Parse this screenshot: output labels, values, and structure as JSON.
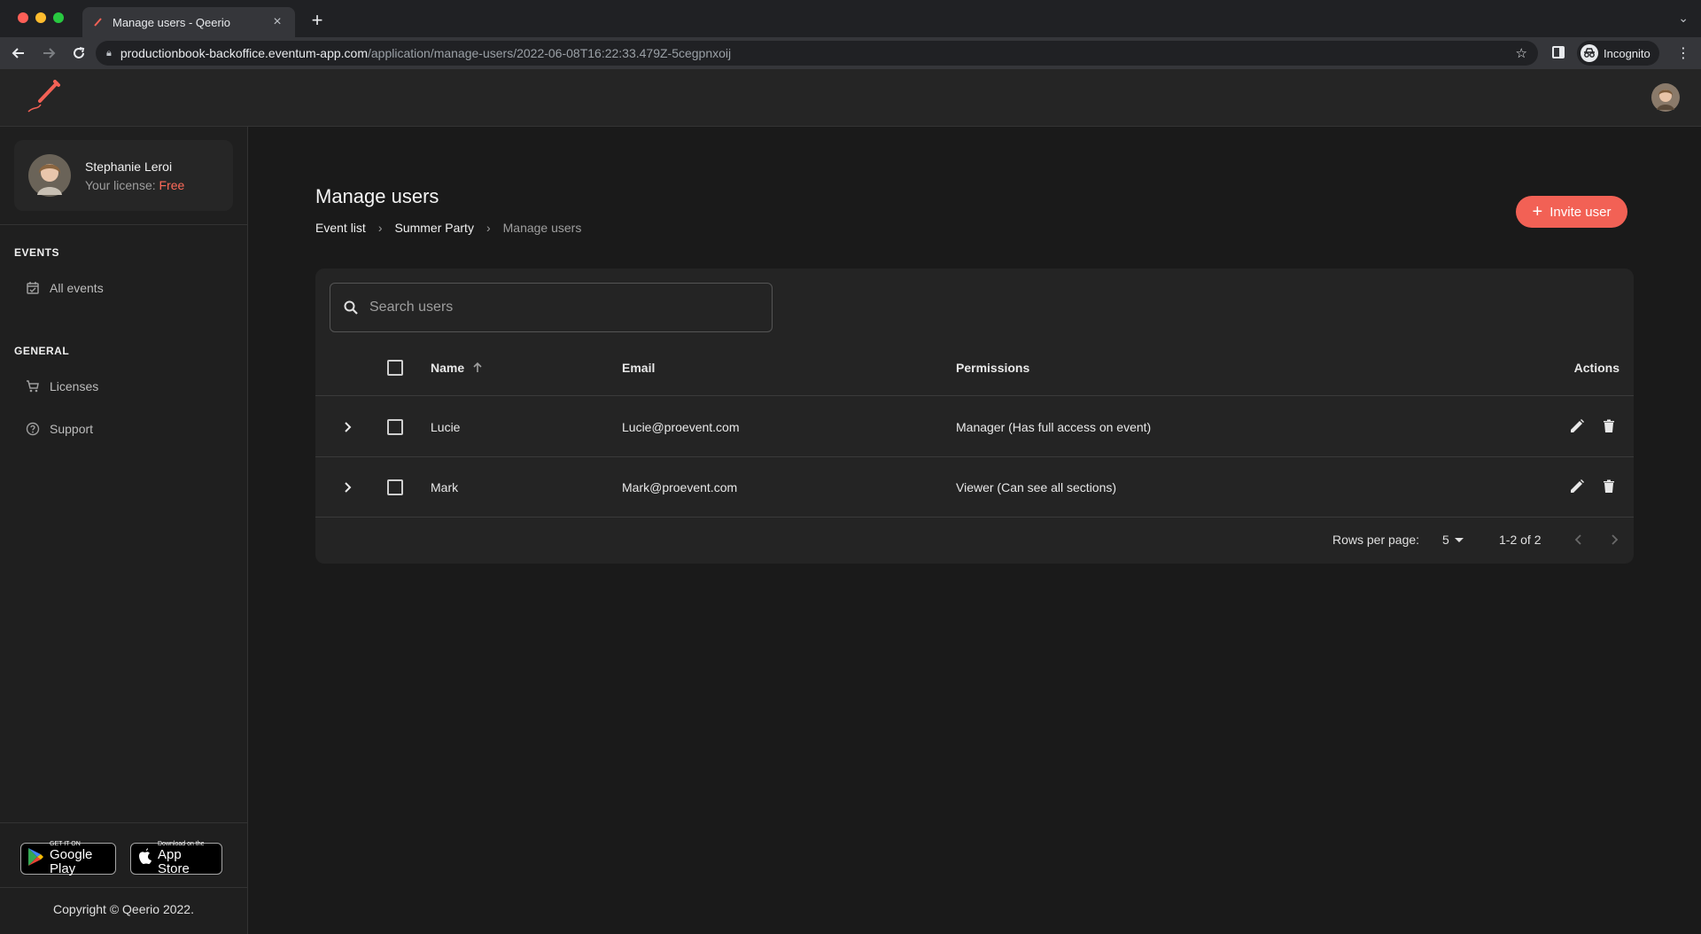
{
  "browser": {
    "tab_title": "Manage users - Qeerio",
    "new_tab_icon": "plus-icon",
    "url_host": "productionbook-backoffice.eventum-app.com",
    "url_path": "/application/manage-users/2022-06-08T16:22:33.479Z-5cegpnxoij",
    "incognito_label": "Incognito"
  },
  "app": {
    "brand_color": "#f26155"
  },
  "sidebar": {
    "profile": {
      "name": "Stephanie Leroi",
      "license_label": "Your license:",
      "license_value": "Free"
    },
    "sections": [
      {
        "title": "EVENTS",
        "items": [
          {
            "label": "All events",
            "icon": "calendar-check-icon"
          }
        ]
      },
      {
        "title": "GENERAL",
        "items": [
          {
            "label": "Licenses",
            "icon": "cart-icon"
          },
          {
            "label": "Support",
            "icon": "help-circle-icon"
          }
        ]
      }
    ],
    "store_badges": {
      "google_small": "GET IT ON",
      "google_big": "Google Play",
      "apple_small": "Download on the",
      "apple_big": "App Store"
    },
    "copyright": "Copyright © Qeerio 2022."
  },
  "main": {
    "title": "Manage users",
    "breadcrumb": [
      "Event list",
      "Summer Party",
      "Manage users"
    ],
    "invite_button": "Invite user",
    "search_placeholder": "Search users",
    "table": {
      "columns": [
        "Name",
        "Email",
        "Permissions",
        "Actions"
      ],
      "rows": [
        {
          "name": "Lucie",
          "email": "Lucie@proevent.com",
          "permissions": "Manager (Has full access on event)"
        },
        {
          "name": "Mark",
          "email": "Mark@proevent.com",
          "permissions": "Viewer (Can see all sections)"
        }
      ],
      "footer": {
        "rows_per_page_label": "Rows per page:",
        "rows_per_page_value": "5",
        "range": "1-2 of 2"
      }
    }
  }
}
